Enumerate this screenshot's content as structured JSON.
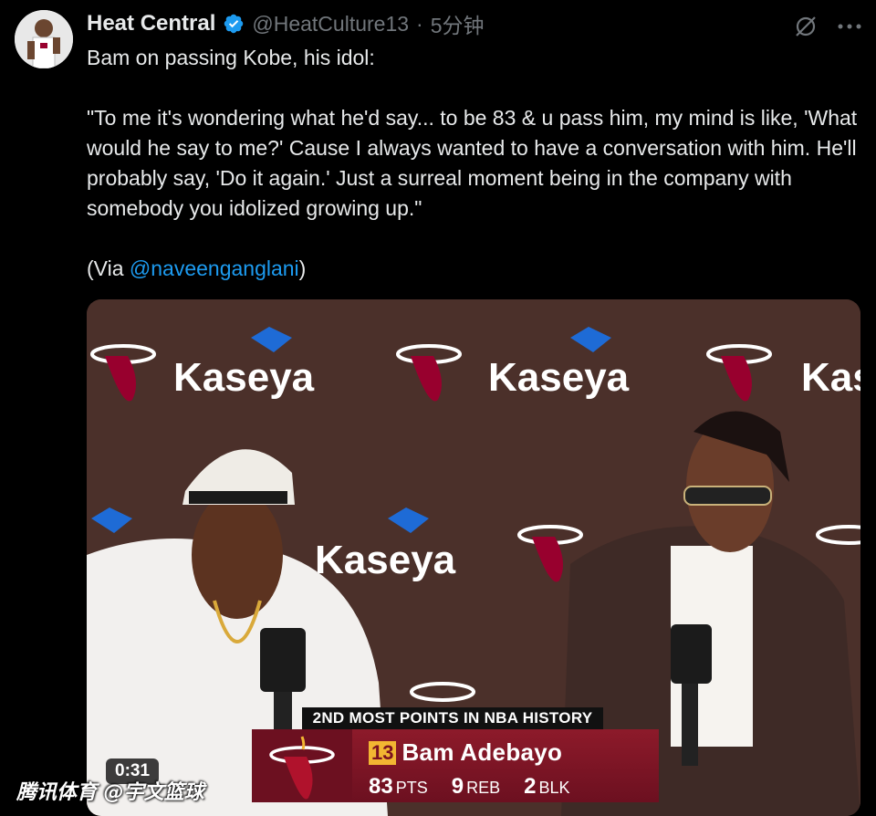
{
  "tweet": {
    "author_name": "Heat Central",
    "handle": "@HeatCulture13",
    "separator": "·",
    "time": "5分钟",
    "text_intro": "Bam on passing Kobe, his idol:",
    "quote": "\"To me it's wondering what he'd say... to be 83 & u pass him, my mind is like, 'What would he say to me?' Cause I always wanted to have a conversation with him. He'll probably say, 'Do it again.' Just a surreal moment being in the company with somebody you idolized growing up.\"",
    "via_prefix": "(Via ",
    "via_mention": "@naveenganglani",
    "via_suffix": ")"
  },
  "icons": {
    "verified": "verified-badge-icon",
    "grok": "grok-icon",
    "more": "more-icon"
  },
  "video": {
    "sponsor_text": "Kaseya",
    "banner_headline": "2ND MOST POINTS IN NBA HISTORY",
    "jersey_number": "13",
    "player_name": "Bam Adebayo",
    "stats": [
      {
        "value": "83",
        "label": "PTS"
      },
      {
        "value": "9",
        "label": "REB"
      },
      {
        "value": "2",
        "label": "BLK"
      }
    ],
    "duration": "0:31",
    "watermark": "腾讯体育 @宇文篮球"
  },
  "colors": {
    "background": "#000000",
    "text": "#e7e9ea",
    "secondary_text": "#71767b",
    "link": "#1d9bf0",
    "verified": "#1d9bf0",
    "heat_red": "#98002e"
  }
}
